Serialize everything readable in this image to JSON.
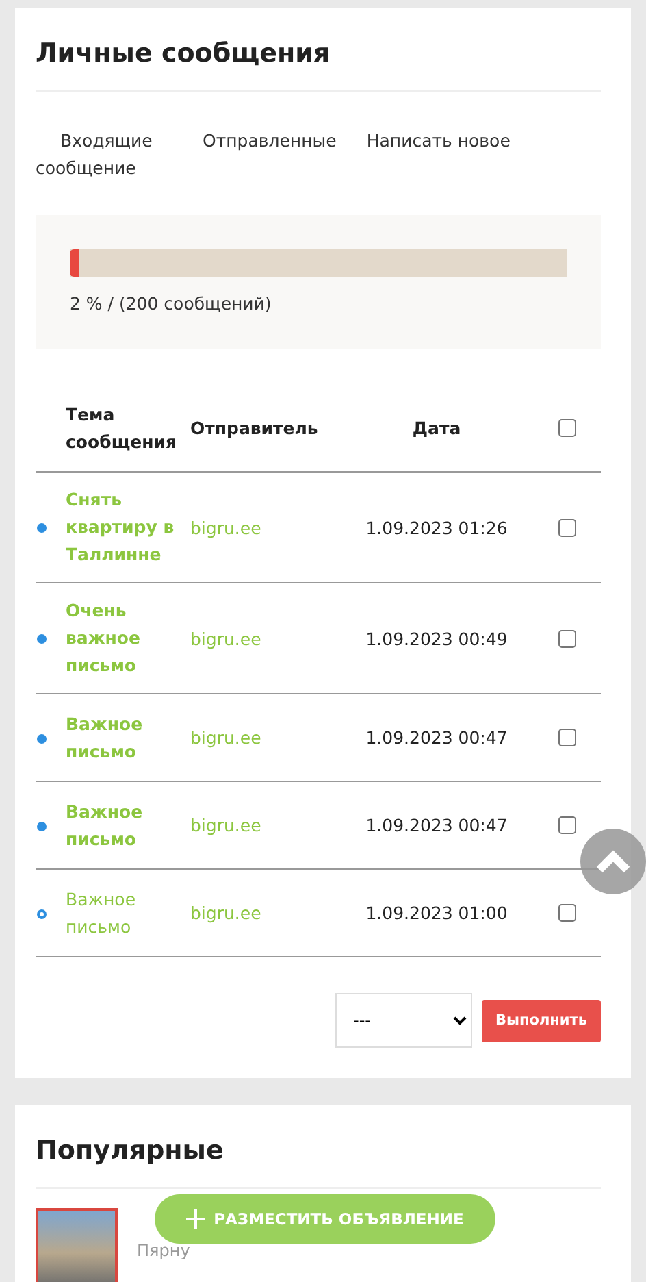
{
  "messages_card": {
    "title": "Личные сообщения",
    "tabs": [
      {
        "label": "Входящие сообщение"
      },
      {
        "label": "Отправленные"
      },
      {
        "label": "Написать новое"
      }
    ],
    "quota": {
      "level": 0.02,
      "caption": "2 % / (200 сообщений)"
    },
    "table": {
      "columns": [
        "Тема сообщения",
        "Отправитель",
        "Дата"
      ],
      "select_all_checked": false,
      "rows": [
        {
          "subject": "Снять квартиру в Таллинне",
          "sender": "bigru.ee",
          "date": "1.09.2023 01:26",
          "unread": true,
          "checked": false
        },
        {
          "subject": "Очень важное письмо",
          "sender": "bigru.ee",
          "date": "1.09.2023 00:49",
          "unread": true,
          "checked": false
        },
        {
          "subject": "Важное письмо",
          "sender": "bigru.ee",
          "date": "1.09.2023 00:47",
          "unread": true,
          "checked": false
        },
        {
          "subject": "Важное письмо",
          "sender": "bigru.ee",
          "date": "1.09.2023 00:47",
          "unread": true,
          "checked": false
        },
        {
          "subject": "Важное письмо",
          "sender": "bigru.ee",
          "date": "1.09.2023 01:00",
          "unread": false,
          "checked": false
        }
      ]
    },
    "action_select": {
      "value": "---"
    },
    "execute_button": "Выполнить"
  },
  "popular_card": {
    "title": "Популярные",
    "listings": [
      {
        "place": "Пярну"
      }
    ]
  },
  "post_ad_button": "РАЗМЕСТИТЬ ОБЪЯВЛЕНИЕ"
}
